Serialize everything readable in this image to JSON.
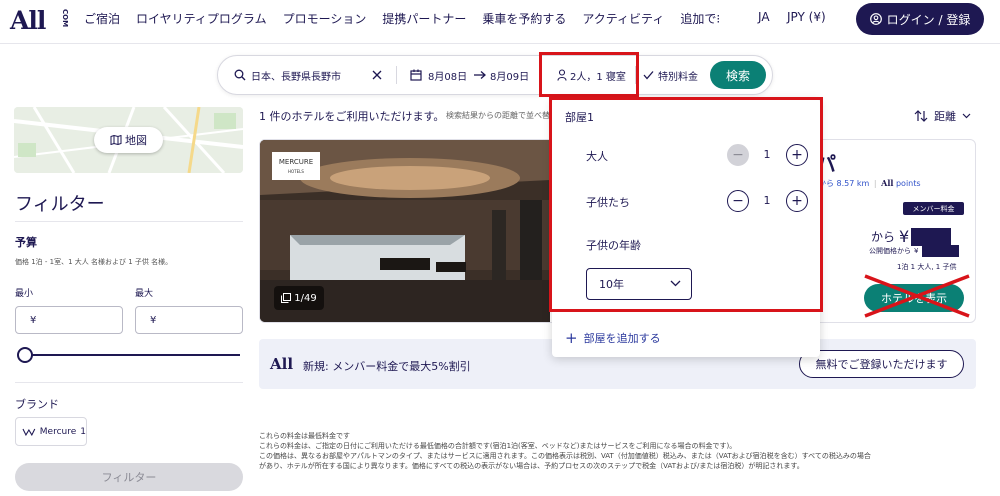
{
  "header": {
    "logo": "All",
    "logo_suffix": "COM",
    "nav": [
      "ご宿泊",
      "ロイヤリティプログラム",
      "プロモーション",
      "提携パートナー",
      "乗車を予約する",
      "アクティビティ",
      "追加で⁝"
    ],
    "language": "JA",
    "currency": "JPY (¥)",
    "login_label": "ログイン / 登録"
  },
  "search": {
    "destination": "日本、長野県長野市",
    "checkin": "8月08日",
    "checkout": "8月09日",
    "guests": "2人，1 寝室",
    "special_rate": "特別料金",
    "search_label": "検索"
  },
  "sidebar": {
    "map_label": "地図",
    "filter_title": "フィルター",
    "budget_title": "予算",
    "budget_desc": "価格 1泊 - 1室、1 大人 名様および 1 子供 名様。",
    "min_label": "最小",
    "max_label": "最大",
    "currency_symbol": "¥",
    "brand_title": "ブランド",
    "brand_name": "Mercure",
    "brand_count": "1",
    "filter_button": "フィルター"
  },
  "results": {
    "count_text": "1 件のホテルをご利用いただけます。",
    "sort_note": "検索結果からの距離で並べ替",
    "sort_label": "距離",
    "hotel": {
      "brand_logo_text": "MERCURE",
      "brand_logo_sub": "HOTELS",
      "image_counter": "1/49",
      "name_fragment": "パ",
      "distance": "から 8.57 km",
      "points_label": "points",
      "member_badge": "メンバー料金",
      "price_from": "から",
      "price_symbol": "¥",
      "public_price": "公開価格から",
      "public_symbol": "¥",
      "stay_info": "1泊 1 大人, 1 子供",
      "book_button": "ホテルを表示"
    }
  },
  "promo": {
    "logo": "All",
    "text": "新規: メンバー料金で最大5%割引",
    "button": "無料でご登録いただけます"
  },
  "footnote": [
    "これらの料金は最低料金です",
    "これらの料金は、ご指定の日付にご利用いただける最低価格の合計額です(宿泊1泊(客室、ベッドなど)またはサービスをご利用になる場合の料金です)。",
    "この価格は、異なるお部屋やアパルトマンのタイプ、またはサービスに適用されます。この価格表示は税別、VAT（付加価値税）税込み、または（VATおよび宿泊税を含む）すべての税込みの場合",
    "があり、ホテルが所在する国により異なります。価格にすべての税込の表示がない場合は、予約プロセスの次のステップで税金（VATおよび/または宿泊税）が明記されます。"
  ],
  "guest_dropdown": {
    "room_label": "部屋1",
    "adults_label": "大人",
    "adults_value": "1",
    "children_label": "子供たち",
    "children_value": "1",
    "child_age_label": "子供の年齢",
    "child_age_value": "10年",
    "add_room": "部屋を追加する"
  },
  "colors": {
    "navy": "#1e1852",
    "teal": "#0b8075",
    "annotation_red": "#d8141a"
  }
}
